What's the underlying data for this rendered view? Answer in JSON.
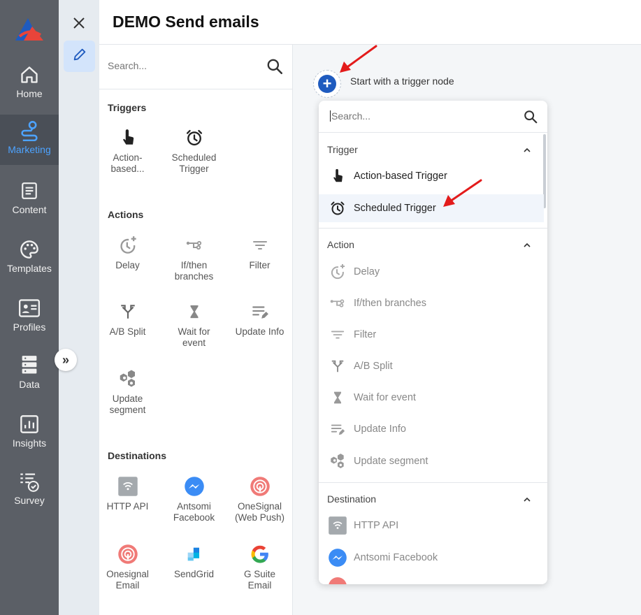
{
  "colors": {
    "accent": "#1f5bbf",
    "nav_bg": "#5b5f66",
    "active_label": "#4da3ff",
    "arrow": "#e31b1b"
  },
  "nav": {
    "items": [
      {
        "label": "Home",
        "icon": "home-icon"
      },
      {
        "label": "Marketing",
        "icon": "marketing-icon",
        "active": true
      },
      {
        "label": "Content",
        "icon": "content-icon"
      },
      {
        "label": "Templates",
        "icon": "palette-icon"
      },
      {
        "label": "Profiles",
        "icon": "profile-card-icon"
      },
      {
        "label": "Data",
        "icon": "database-icon"
      },
      {
        "label": "Insights",
        "icon": "chart-icon"
      },
      {
        "label": "Survey",
        "icon": "survey-icon"
      }
    ]
  },
  "header": {
    "title": "DEMO Send emails"
  },
  "palette": {
    "search_placeholder": "Search...",
    "sections": {
      "triggers": "Triggers",
      "actions": "Actions",
      "destinations": "Destinations"
    },
    "triggers": [
      {
        "label": "Action-\nbased...",
        "icon": "hand-pointer-icon"
      },
      {
        "label": "Scheduled\nTrigger",
        "icon": "alarm-clock-icon"
      }
    ],
    "actions": [
      {
        "label": "Delay",
        "icon": "delay-clock-icon"
      },
      {
        "label": "If/then\nbranches",
        "icon": "branch-icon"
      },
      {
        "label": "Filter",
        "icon": "filter-lines-icon"
      },
      {
        "label": "A/B Split",
        "icon": "split-icon"
      },
      {
        "label": "Wait for\nevent",
        "icon": "hourglass-icon"
      },
      {
        "label": "Update Info",
        "icon": "update-info-icon"
      },
      {
        "label": "Update\nsegment",
        "icon": "segment-icon"
      }
    ],
    "destinations": [
      {
        "label": "HTTP API",
        "icon": "http-api-icon"
      },
      {
        "label": "Antsomi\nFacebook",
        "icon": "messenger-icon"
      },
      {
        "label": "OneSignal\n(Web Push)",
        "icon": "onesignal-icon"
      },
      {
        "label": "Onesignal\nEmail",
        "icon": "onesignal-icon"
      },
      {
        "label": "SendGrid",
        "icon": "sendgrid-icon"
      },
      {
        "label": "G Suite\nEmail",
        "icon": "google-icon"
      }
    ]
  },
  "canvas": {
    "hint": "Start with a trigger node"
  },
  "dropdown": {
    "search_placeholder": "Search...",
    "groups": {
      "trigger": "Trigger",
      "action": "Action",
      "destination": "Destination"
    },
    "trigger_items": [
      {
        "label": "Action-based Trigger",
        "icon": "hand-pointer-icon"
      },
      {
        "label": "Scheduled Trigger",
        "icon": "alarm-clock-icon"
      }
    ],
    "action_items": [
      {
        "label": "Delay",
        "icon": "delay-clock-icon"
      },
      {
        "label": "If/then branches",
        "icon": "branch-icon"
      },
      {
        "label": "Filter",
        "icon": "filter-lines-icon"
      },
      {
        "label": "A/B Split",
        "icon": "split-icon"
      },
      {
        "label": "Wait for event",
        "icon": "hourglass-icon"
      },
      {
        "label": "Update Info",
        "icon": "update-info-icon"
      },
      {
        "label": "Update segment",
        "icon": "segment-icon"
      }
    ],
    "destination_items": [
      {
        "label": "HTTP API",
        "icon": "http-api-icon"
      },
      {
        "label": "Antsomi Facebook",
        "icon": "messenger-icon"
      }
    ]
  }
}
